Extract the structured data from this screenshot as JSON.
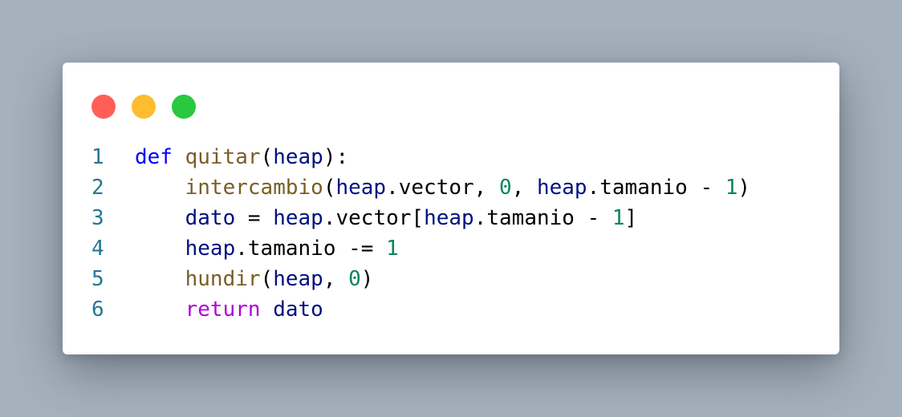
{
  "colors": {
    "background": "#a5b1bd",
    "window_bg": "#ffffff",
    "dot_close": "#ff5f57",
    "dot_minimize": "#febc2e",
    "dot_maximize": "#28c840",
    "line_number": "#237893",
    "keyword": "#0000ff",
    "control_keyword": "#af00db",
    "function": "#795e26",
    "variable": "#001080",
    "number": "#098658",
    "text": "#000000"
  },
  "code": {
    "lines": [
      {
        "number": "1",
        "tokens": [
          {
            "text": "def",
            "kind": "keyword"
          },
          {
            "text": " ",
            "kind": "text"
          },
          {
            "text": "quitar",
            "kind": "function"
          },
          {
            "text": "(",
            "kind": "text"
          },
          {
            "text": "heap",
            "kind": "variable"
          },
          {
            "text": "):",
            "kind": "text"
          }
        ]
      },
      {
        "number": "2",
        "tokens": [
          {
            "text": "    ",
            "kind": "text"
          },
          {
            "text": "intercambio",
            "kind": "function"
          },
          {
            "text": "(",
            "kind": "text"
          },
          {
            "text": "heap",
            "kind": "variable"
          },
          {
            "text": ".vector, ",
            "kind": "text"
          },
          {
            "text": "0",
            "kind": "number"
          },
          {
            "text": ", ",
            "kind": "text"
          },
          {
            "text": "heap",
            "kind": "variable"
          },
          {
            "text": ".tamanio - ",
            "kind": "text"
          },
          {
            "text": "1",
            "kind": "number"
          },
          {
            "text": ")",
            "kind": "text"
          }
        ]
      },
      {
        "number": "3",
        "tokens": [
          {
            "text": "    ",
            "kind": "text"
          },
          {
            "text": "dato",
            "kind": "variable"
          },
          {
            "text": " = ",
            "kind": "text"
          },
          {
            "text": "heap",
            "kind": "variable"
          },
          {
            "text": ".vector[",
            "kind": "text"
          },
          {
            "text": "heap",
            "kind": "variable"
          },
          {
            "text": ".tamanio - ",
            "kind": "text"
          },
          {
            "text": "1",
            "kind": "number"
          },
          {
            "text": "]",
            "kind": "text"
          }
        ]
      },
      {
        "number": "4",
        "tokens": [
          {
            "text": "    ",
            "kind": "text"
          },
          {
            "text": "heap",
            "kind": "variable"
          },
          {
            "text": ".tamanio -= ",
            "kind": "text"
          },
          {
            "text": "1",
            "kind": "number"
          }
        ]
      },
      {
        "number": "5",
        "tokens": [
          {
            "text": "    ",
            "kind": "text"
          },
          {
            "text": "hundir",
            "kind": "function"
          },
          {
            "text": "(",
            "kind": "text"
          },
          {
            "text": "heap",
            "kind": "variable"
          },
          {
            "text": ", ",
            "kind": "text"
          },
          {
            "text": "0",
            "kind": "number"
          },
          {
            "text": ")",
            "kind": "text"
          }
        ]
      },
      {
        "number": "6",
        "tokens": [
          {
            "text": "    ",
            "kind": "text"
          },
          {
            "text": "return",
            "kind": "control_keyword"
          },
          {
            "text": " ",
            "kind": "text"
          },
          {
            "text": "dato",
            "kind": "variable"
          }
        ]
      }
    ]
  }
}
